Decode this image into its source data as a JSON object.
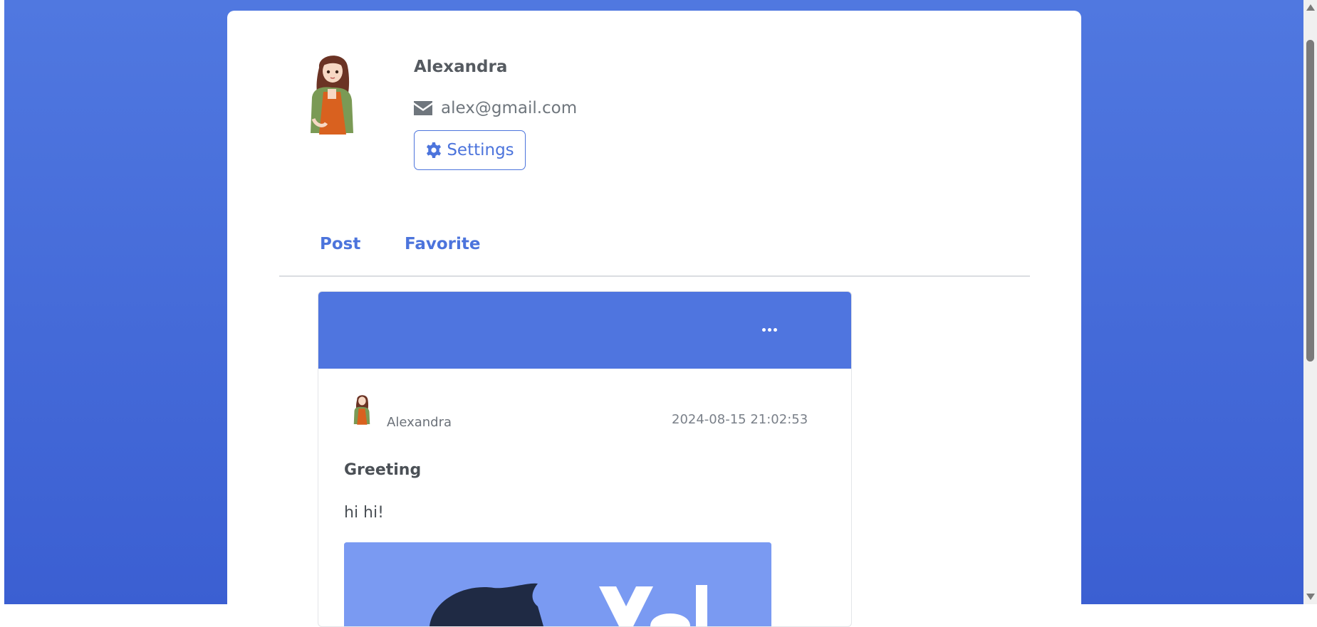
{
  "profile": {
    "name": "Alexandra",
    "email": "alex@gmail.com",
    "settings_label": "Settings"
  },
  "tabs": [
    {
      "label": "Post"
    },
    {
      "label": "Favorite"
    }
  ],
  "post": {
    "author": "Alexandra",
    "timestamp": "2024-08-15 21:02:53",
    "title": "Greeting",
    "body": "hi hi!",
    "more_icon": "ellipsis-icon"
  },
  "colors": {
    "accent": "#4c74dc",
    "background_top": "#5078e0",
    "background_bottom": "#3b5fd2",
    "post_header": "#4f75df"
  }
}
